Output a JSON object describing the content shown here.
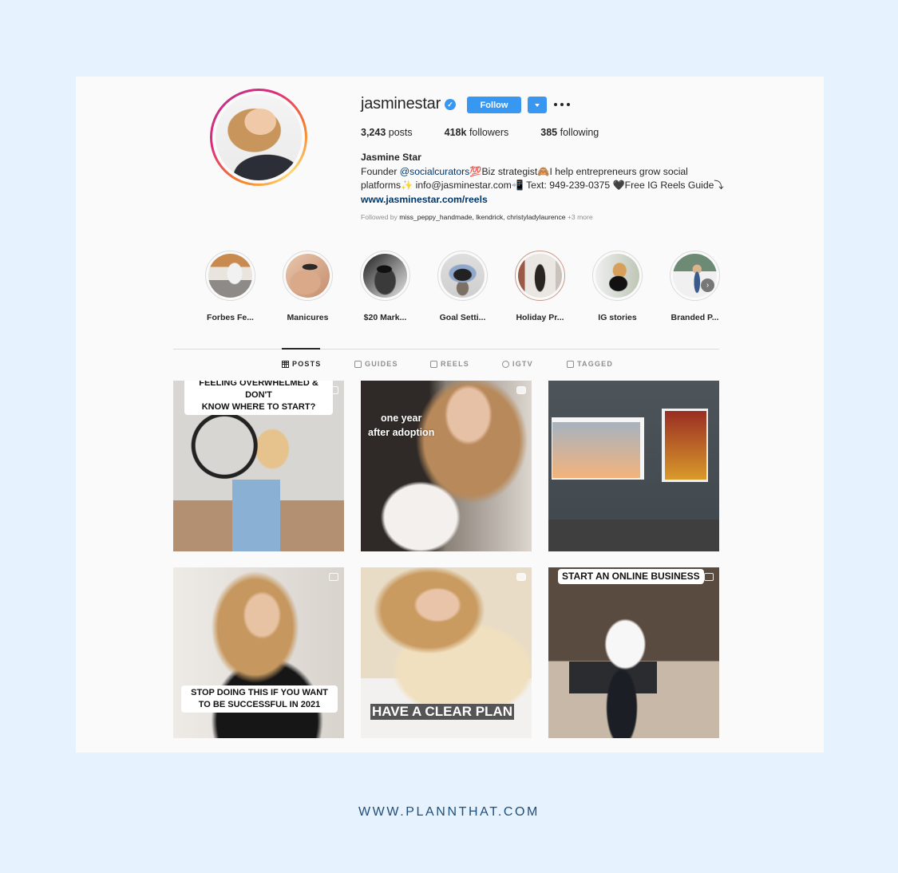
{
  "profile": {
    "username": "jasminestar",
    "verified": true,
    "follow_label": "Follow",
    "stats": [
      {
        "value": "3,243",
        "label": "posts"
      },
      {
        "value": "418k",
        "label": "followers"
      },
      {
        "value": "385",
        "label": "following"
      }
    ],
    "full_name": "Jasmine Star",
    "bio": {
      "prefix": "Founder ",
      "mention": "@socialcurators",
      "line1_rest": "💯Biz strategist🙈I help entrepreneurs grow social",
      "line2": "platforms✨ info@jasminestar.com📲 Text: 949-239-0375 🖤Free IG Reels Guide⤵",
      "link": "www.jasminestar.com/reels"
    },
    "followed_by": {
      "prefix": "Followed by ",
      "users": "miss_peppy_handmade, lkendrick, christyladylaurence",
      "more": " +3 more"
    }
  },
  "highlights": [
    {
      "label": "Forbes Fe..."
    },
    {
      "label": "Manicures"
    },
    {
      "label": "$20 Mark..."
    },
    {
      "label": "Goal Setti..."
    },
    {
      "label": "Holiday Pr..."
    },
    {
      "label": "IG stories"
    },
    {
      "label": "Branded P..."
    }
  ],
  "tabs": [
    {
      "label": "POSTS",
      "icon": "grid-icon",
      "active": true
    },
    {
      "label": "GUIDES",
      "icon": "guides-icon",
      "active": false
    },
    {
      "label": "REELS",
      "icon": "reels-icon",
      "active": false
    },
    {
      "label": "IGTV",
      "icon": "igtv-icon",
      "active": false
    },
    {
      "label": "TAGGED",
      "icon": "tagged-icon",
      "active": false
    }
  ],
  "posts": [
    {
      "caption": "FEELING OVERWHELMED & DON'T\nKNOW WHERE TO START?",
      "type_icon": "reel-icon"
    },
    {
      "caption": "one year\nafter adoption",
      "type_icon": "igtv-icon"
    },
    {
      "caption": "",
      "type_icon": ""
    },
    {
      "caption": "STOP DOING THIS IF YOU WANT\nTO BE SUCCESSFUL IN 2021",
      "type_icon": "reel-icon"
    },
    {
      "caption": "HAVE A CLEAR PLAN",
      "type_icon": "igtv-icon"
    },
    {
      "caption": "START AN ONLINE BUSINESS",
      "type_icon": "reel-icon"
    }
  ],
  "footer": {
    "url": "WWW.PLANNTHAT.COM"
  }
}
